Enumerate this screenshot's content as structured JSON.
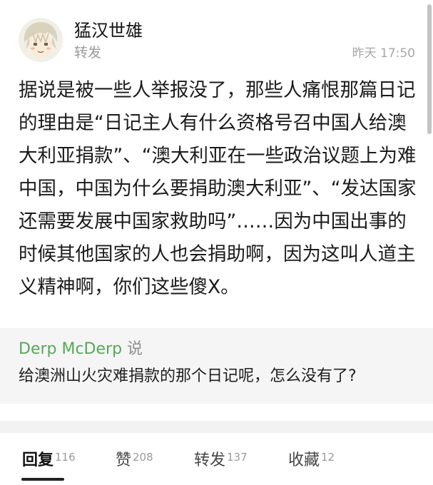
{
  "header": {
    "author": "猛汉世雄",
    "type": "转发",
    "time": "昨天 17:50",
    "avatar_icon": "anime-character-avatar"
  },
  "post": {
    "text": "据说是被一些人举报没了，那些人痛恨那篇日记的理由是“日记主人有什么资格号召中国人给澳大利亚捐款”、“澳大利亚在一些政治议题上为难中国，中国为什么要捐助澳大利亚”、“发达国家还需要发展中国家救助吗”……因为中国出事的时候其他国家的人也会捐助啊，因为这叫人道主义精神啊，你们这些傻X。"
  },
  "quote": {
    "user": "Derp McDerp",
    "says": "说",
    "text": "给澳洲山火灾难捐款的那个日记呢，怎么没有了?"
  },
  "tabs": [
    {
      "label": "回复",
      "count": "116"
    },
    {
      "label": "赞",
      "count": "208"
    },
    {
      "label": "转发",
      "count": "137"
    },
    {
      "label": "收藏",
      "count": "12"
    }
  ],
  "colors": {
    "quote_user": "#57a85a",
    "muted": "#9a9a9a",
    "quote_bg": "#f5f5f5"
  }
}
